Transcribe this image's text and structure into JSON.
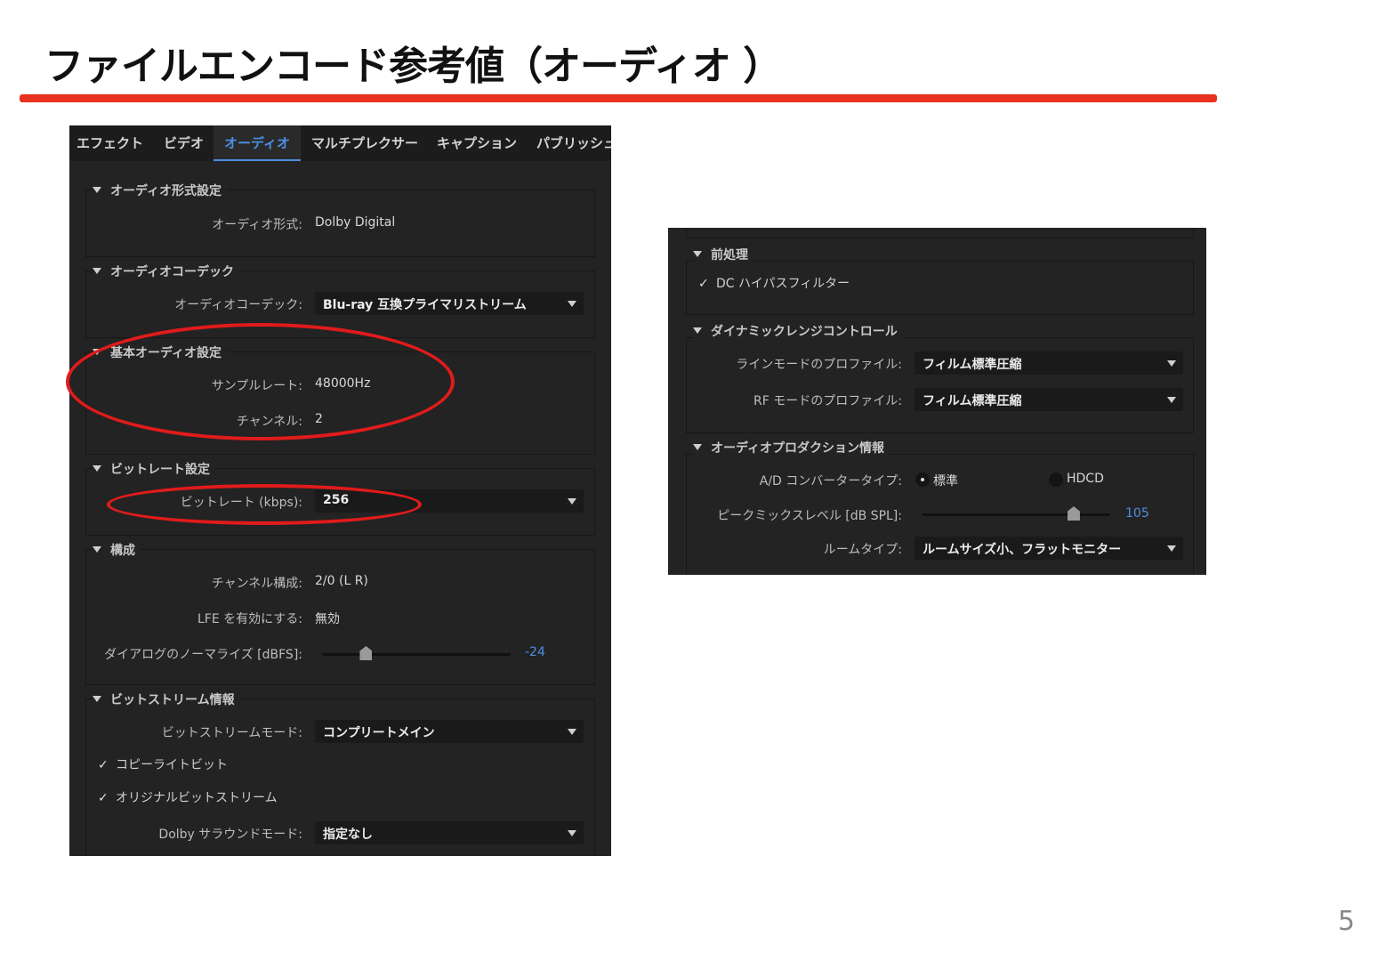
{
  "slide": {
    "title": "ファイルエンコード参考値（オーディオ ）",
    "page_number": "5"
  },
  "tabs": [
    {
      "label": "エフェクト"
    },
    {
      "label": "ビデオ"
    },
    {
      "label": "オーディオ",
      "active": true
    },
    {
      "label": "マルチプレクサー"
    },
    {
      "label": "キャプション"
    },
    {
      "label": "パブリッシュ"
    }
  ],
  "left": {
    "audio_format": {
      "header": "オーディオ形式設定",
      "label": "オーディオ形式:",
      "value": "Dolby Digital"
    },
    "codec": {
      "header": "オーディオコーデック",
      "label": "オーディオコーデック:",
      "value": "Blu-ray 互換プライマリストリーム"
    },
    "basic": {
      "header": "基本オーディオ設定",
      "sample_rate_label": "サンプルレート:",
      "sample_rate_value": "48000Hz",
      "channels_label": "チャンネル:",
      "channels_value": "2"
    },
    "bitrate": {
      "header": "ビットレート設定",
      "label": "ビットレート (kbps):",
      "value": "256"
    },
    "config": {
      "header": "構成",
      "channel_config_label": "チャンネル構成:",
      "channel_config_value": "2/0 (L R)",
      "lfe_label": "LFE を有効にする:",
      "lfe_value": "無効",
      "dialog_label": "ダイアログのノーマライズ [dBFS]:",
      "dialog_value": "-24",
      "dialog_min": -31,
      "dialog_max": -1
    },
    "bitstream": {
      "header": "ビットストリーム情報",
      "mode_label": "ビットストリームモード:",
      "mode_value": "コンプリートメイン",
      "copyright_label": "コピーライトビット",
      "copyright_checked": true,
      "original_label": "オリジナルビットストリーム",
      "original_checked": true,
      "surround_label": "Dolby サラウンドモード:",
      "surround_value": "指定なし"
    }
  },
  "right": {
    "preprocess": {
      "header": "前処理",
      "dc_filter_label": "DC ハイパスフィルター",
      "dc_filter_checked": true
    },
    "drc": {
      "header": "ダイナミックレンジコントロール",
      "line_label": "ラインモードのプロファイル:",
      "line_value": "フィルム標準圧縮",
      "rf_label": "RF モードのプロファイル:",
      "rf_value": "フィルム標準圧縮"
    },
    "production": {
      "header": "オーディオプロダクション情報",
      "ad_label": "A/D コンバータータイプ:",
      "ad_option_standard": "標準",
      "ad_option_hdcd": "HDCD",
      "ad_selected": "標準",
      "peak_label": "ピークミックスレベル [dB SPL]:",
      "peak_value": "105",
      "peak_min": 80,
      "peak_max": 111,
      "room_label": "ルームタイプ:",
      "room_value": "ルームサイズ小、フラットモニター"
    }
  },
  "highlight_color": "#e01b1b",
  "accent_color": "#4a90e2"
}
